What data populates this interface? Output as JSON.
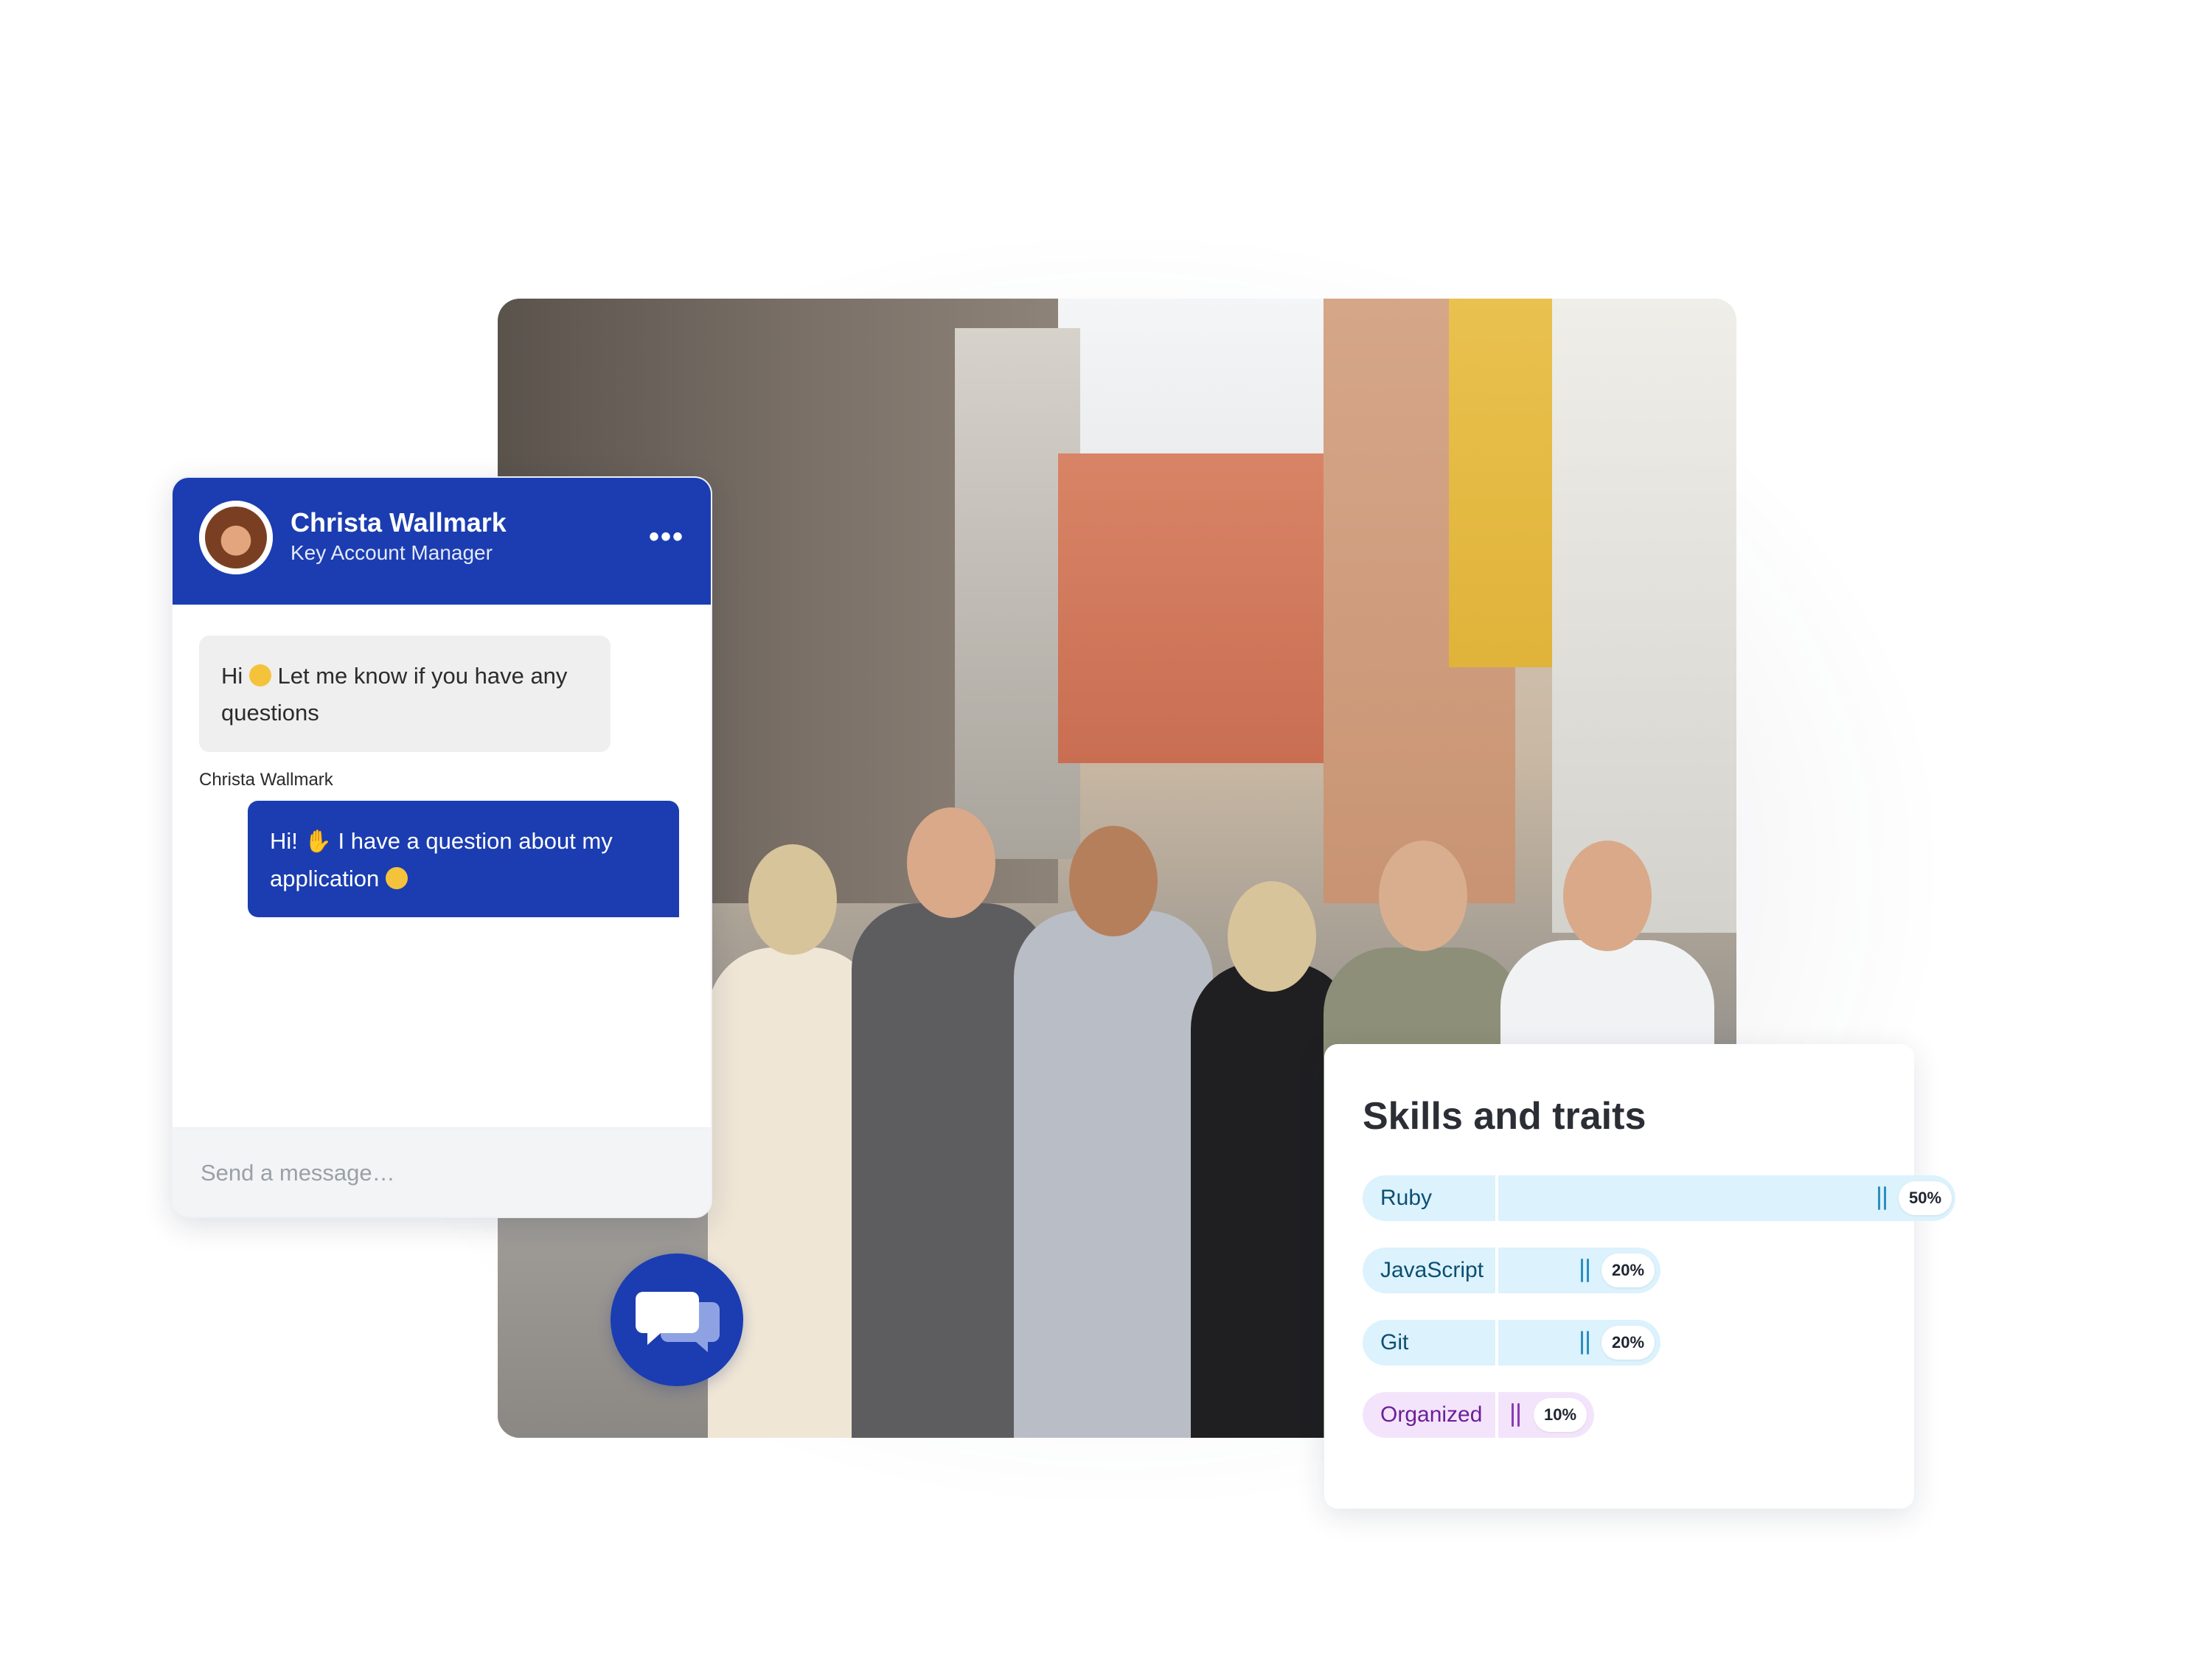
{
  "chat": {
    "agent_name": "Christa Wallmark",
    "agent_role": "Key Account Manager",
    "menu_icon": "more-horizontal-icon",
    "messages": [
      {
        "direction": "incoming",
        "text_before": "Hi",
        "emoji": "smiling-face",
        "text_after": "Let me know if you have any questions",
        "author": "Christa Wallmark"
      },
      {
        "direction": "outgoing",
        "text_before": "Hi!",
        "emoji": "waving-hand",
        "text_after": "I have a question about my application",
        "trailing_emoji": "smiling-face"
      }
    ],
    "input_placeholder": "Send a message…"
  },
  "fab": {
    "icon": "chat-bubbles-icon"
  },
  "skills": {
    "title": "Skills and traits",
    "items": [
      {
        "label": "Ruby",
        "percent": "50%",
        "value": 0.5,
        "color": "blue"
      },
      {
        "label": "JavaScript",
        "percent": "20%",
        "value": 0.2,
        "color": "blue"
      },
      {
        "label": "Git",
        "percent": "20%",
        "value": 0.2,
        "color": "blue"
      },
      {
        "label": "Organized",
        "percent": "10%",
        "value": 0.1,
        "color": "purple"
      }
    ]
  },
  "colors": {
    "brand_blue": "#1b3db1",
    "skill_blue_bg": "#dcf2fd",
    "skill_purple_bg": "#f3e4fb"
  }
}
